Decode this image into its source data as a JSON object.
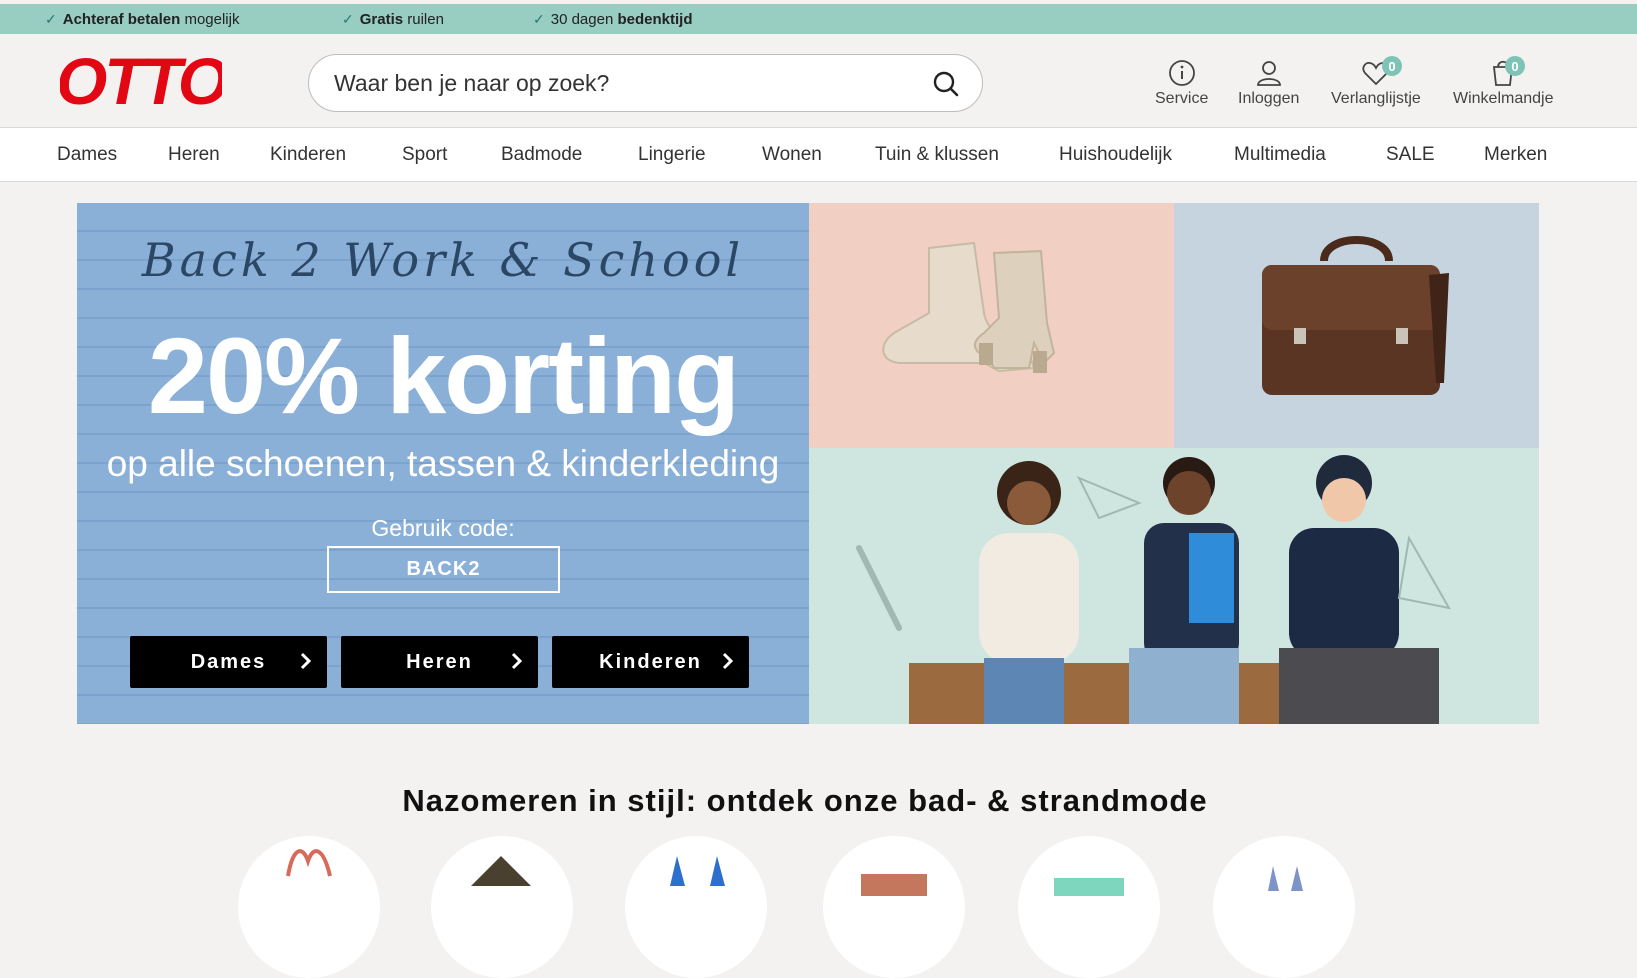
{
  "usp": [
    {
      "bold": "Achteraf betalen",
      "text": " mogelijk"
    },
    {
      "bold": "Gratis",
      "text": " ruilen"
    },
    {
      "text": "30 dagen ",
      "bold": "bedenktijd"
    }
  ],
  "header": {
    "logo": "OTTO",
    "search_placeholder": "Waar ben je naar op zoek?",
    "items": [
      {
        "label": "Service",
        "icon": "info-icon"
      },
      {
        "label": "Inloggen",
        "icon": "user-icon"
      },
      {
        "label": "Verlanglijstje",
        "icon": "heart-icon",
        "badge": "0"
      },
      {
        "label": "Winkelmandje",
        "icon": "cart-icon",
        "badge": "0"
      }
    ]
  },
  "nav": [
    "Dames",
    "Heren",
    "Kinderen",
    "Sport",
    "Badmode",
    "Lingerie",
    "Wonen",
    "Tuin & klussen",
    "Huishoudelijk",
    "Multimedia",
    "SALE",
    "Merken"
  ],
  "hero": {
    "subtitle": "Back 2 Work & School",
    "title": "20% korting",
    "description": "op alle schoenen, tassen & kinderkleding",
    "code_label": "Gebruik code:",
    "code": "BACK2",
    "buttons": [
      "Dames",
      "Heren",
      "Kinderen"
    ]
  },
  "section": {
    "title": "Nazomeren in stijl: ontdek onze bad- & strandmode"
  },
  "colors": {
    "usp_bar": "#98cdc2",
    "brand_red": "#e30613",
    "badge": "#7fc3b6",
    "hero_blue": "#8bb0d8"
  }
}
